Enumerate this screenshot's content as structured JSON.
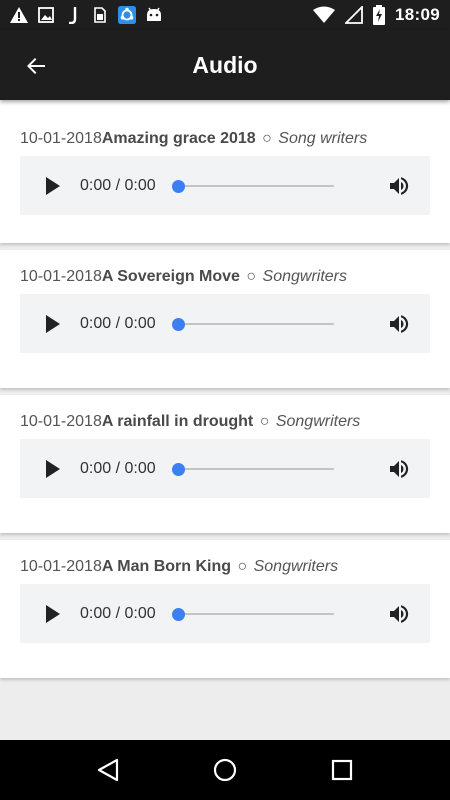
{
  "status_bar": {
    "time": "18:09",
    "left_icons": [
      "warning-icon",
      "image-icon",
      "j-icon",
      "sim-card-icon",
      "sync-app-icon",
      "android-icon"
    ],
    "right_icons": [
      "wifi-icon",
      "signal-icon",
      "battery-charging-icon"
    ]
  },
  "app_bar": {
    "title": "Audio",
    "back_icon": "arrow-left-icon"
  },
  "audio_items": [
    {
      "date": "10-01-2018",
      "title": "Amazing grace 2018",
      "separator": "○",
      "category": "Song writers",
      "time": "0:00 / 0:00",
      "progress": 0
    },
    {
      "date": "10-01-2018",
      "title": "A Sovereign Move",
      "separator": "○",
      "category": "Songwriters",
      "time": "0:00 / 0:00",
      "progress": 0
    },
    {
      "date": "10-01-2018",
      "title": "A rainfall in drought",
      "separator": "○",
      "category": "Songwriters",
      "time": "0:00 / 0:00",
      "progress": 0
    },
    {
      "date": "10-01-2018",
      "title": "A Man Born King",
      "separator": "○",
      "category": "Songwriters",
      "time": "0:00 / 0:00",
      "progress": 0
    }
  ],
  "colors": {
    "app_bar": "#1e1e1e",
    "background": "#ededed",
    "player_bg": "#f1f3f4",
    "seek_thumb": "#3b7ff0"
  },
  "nav_bar": {
    "buttons": [
      "back-triangle-icon",
      "home-circle-icon",
      "recents-square-icon"
    ]
  }
}
